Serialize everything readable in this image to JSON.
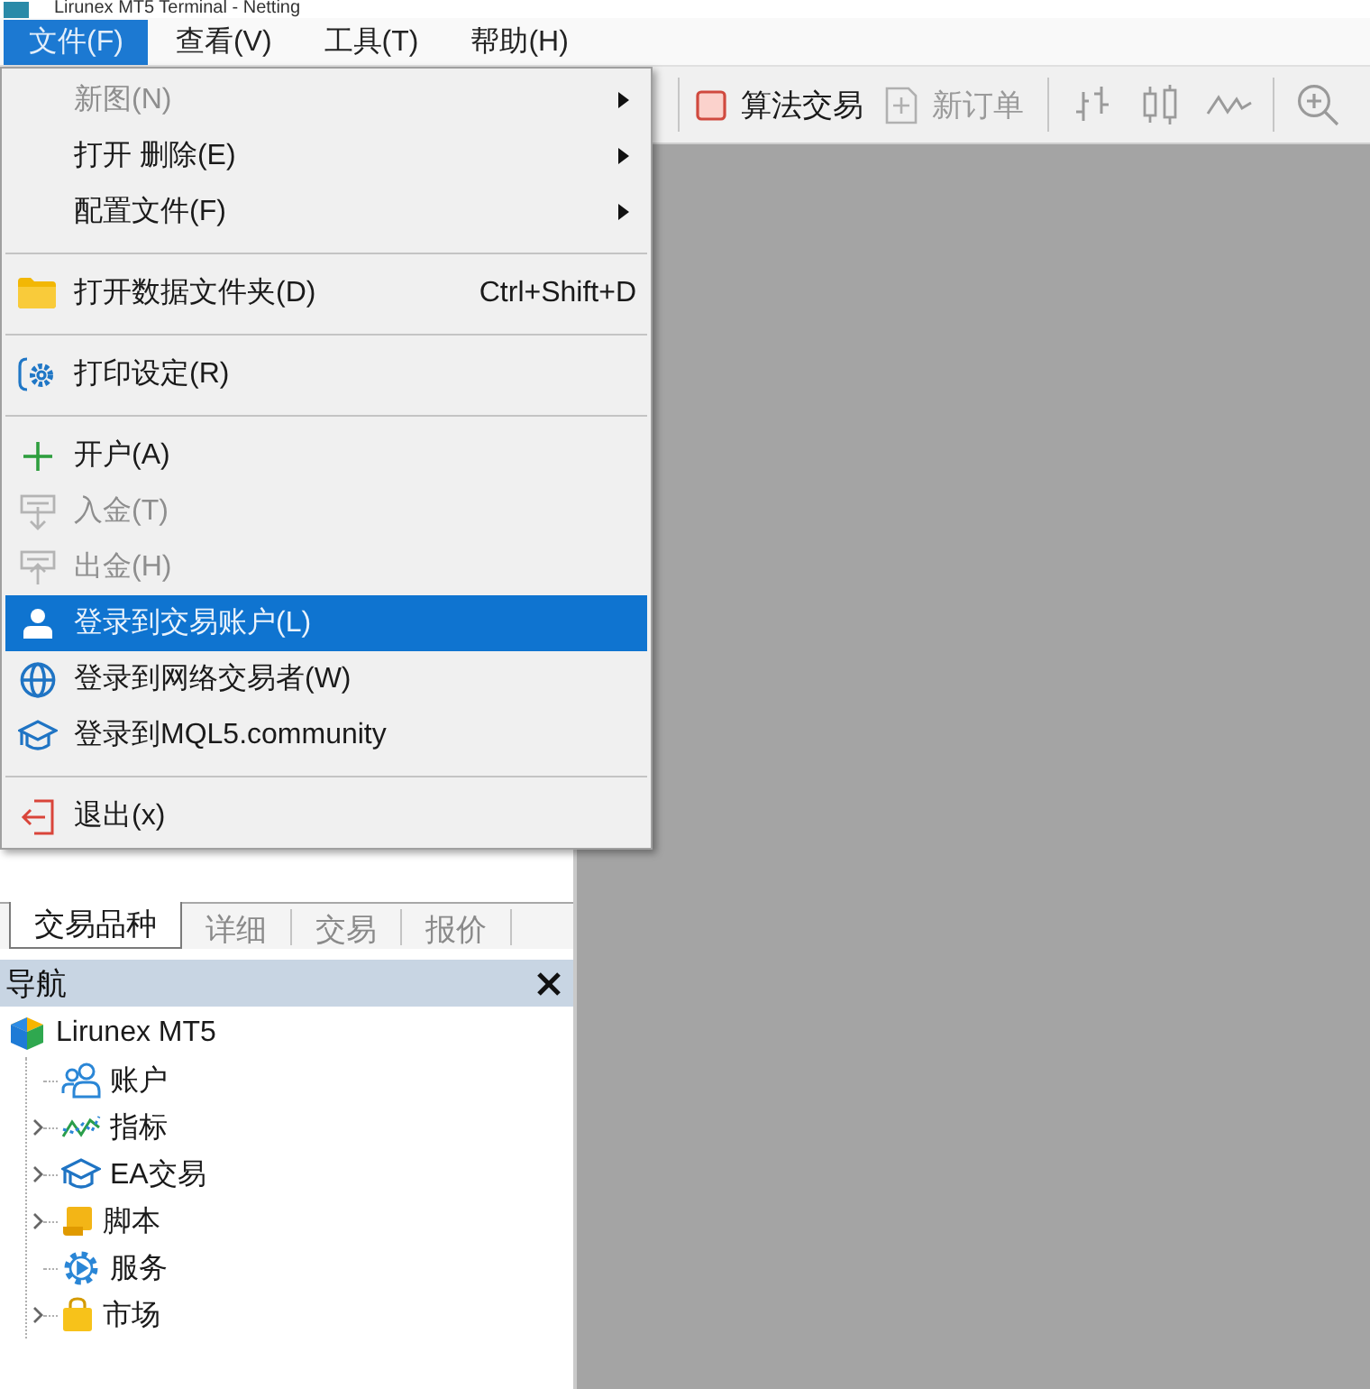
{
  "window": {
    "title": "Lirunex MT5 Terminal - Netting"
  },
  "menu_bar": [
    {
      "label": "文件(F)",
      "selected": true
    },
    {
      "label": "查看(V)",
      "selected": false
    },
    {
      "label": "工具(T)",
      "selected": false
    },
    {
      "label": "帮助(H)",
      "selected": false
    }
  ],
  "file_menu": {
    "items": [
      {
        "kind": "item",
        "label": "新图(N)",
        "disabled": true,
        "selected": false,
        "submenu": true
      },
      {
        "kind": "item",
        "label": "打开 删除(E)",
        "disabled": false,
        "selected": false,
        "submenu": true
      },
      {
        "kind": "item",
        "label": "配置文件(F)",
        "disabled": false,
        "selected": false,
        "submenu": true
      },
      {
        "kind": "separator"
      },
      {
        "kind": "item",
        "label": "打开数据文件夹(D)",
        "shortcut": "Ctrl+Shift+D",
        "disabled": false,
        "selected": false,
        "submenu": false
      },
      {
        "kind": "separator"
      },
      {
        "kind": "item",
        "label": "打印设定(R)",
        "disabled": false,
        "selected": false,
        "submenu": false
      },
      {
        "kind": "separator"
      },
      {
        "kind": "item",
        "label": "开户(A)",
        "disabled": false,
        "selected": false,
        "submenu": false
      },
      {
        "kind": "item",
        "label": "入金(T)",
        "disabled": true,
        "selected": false,
        "submenu": false
      },
      {
        "kind": "item",
        "label": "出金(H)",
        "disabled": true,
        "selected": false,
        "submenu": false
      },
      {
        "kind": "item",
        "label": "登录到交易账户(L)",
        "disabled": false,
        "selected": true,
        "submenu": false
      },
      {
        "kind": "item",
        "label": "登录到网络交易者(W)",
        "disabled": false,
        "selected": false,
        "submenu": false
      },
      {
        "kind": "item",
        "label": "登录到MQL5.community",
        "disabled": false,
        "selected": false,
        "submenu": false
      },
      {
        "kind": "separator"
      },
      {
        "kind": "item",
        "label": "退出(x)",
        "disabled": false,
        "selected": false,
        "submenu": false
      }
    ]
  },
  "toolbar": {
    "buttons": [
      {
        "label": "算法交易",
        "disabled": false
      },
      {
        "label": "新订单",
        "disabled": true
      }
    ]
  },
  "panel_tabs": [
    {
      "label": "交易品种",
      "selected": true
    },
    {
      "label": "详细",
      "selected": false
    },
    {
      "label": "交易",
      "selected": false
    },
    {
      "label": "报价",
      "selected": false
    }
  ],
  "navigator": {
    "title": "导航",
    "tree": {
      "label": "Lirunex MT5",
      "children": [
        {
          "label": "账户",
          "collapsed": false
        },
        {
          "label": "指标",
          "collapsed": true
        },
        {
          "label": "EA交易",
          "collapsed": true
        },
        {
          "label": "脚本",
          "collapsed": true
        },
        {
          "label": "服务",
          "collapsed": false
        },
        {
          "label": "市场",
          "collapsed": true
        }
      ]
    }
  }
}
